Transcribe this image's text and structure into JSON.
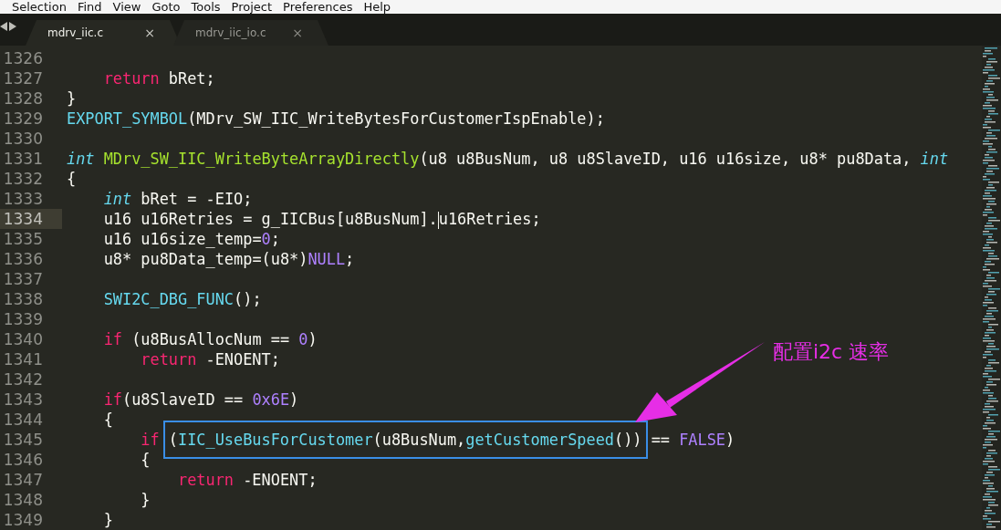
{
  "menu": [
    "Selection",
    "Find",
    "View",
    "Goto",
    "Tools",
    "Project",
    "Preferences",
    "Help"
  ],
  "tabs": [
    {
      "label": "mdrv_iic.c",
      "selected": true,
      "close": "×"
    },
    {
      "label": "mdrv_iic_io.c",
      "selected": false,
      "close": "×"
    }
  ],
  "editor": {
    "lines": [
      {
        "number": "1326",
        "current": false
      },
      {
        "number": "1327",
        "current": false,
        "tokens": [
          {
            "kind": "keyword",
            "text": "    return"
          },
          {
            "kind": "plain",
            "text": " bRet;"
          }
        ]
      },
      {
        "number": "1328",
        "current": false,
        "tokens": [
          {
            "kind": "plain",
            "text": "}"
          }
        ]
      },
      {
        "number": "1329",
        "current": false,
        "tokens": [
          {
            "kind": "call",
            "text": "EXPORT_SYMBOL"
          },
          {
            "kind": "plain",
            "text": "(MDrv_SW_IIC_WriteBytesForCustomerIspEnable);"
          }
        ]
      },
      {
        "number": "1330",
        "current": false
      },
      {
        "number": "1331",
        "current": false,
        "tokens": [
          {
            "kind": "type",
            "text": "int"
          },
          {
            "kind": "function",
            "text": " MDrv_SW_IIC_WriteByteArrayDirectly"
          },
          {
            "kind": "plain",
            "text": "(u8 u8BusNum, u8 u8SlaveID, u16 u16size, u8* pu8Data,"
          },
          {
            "kind": "type",
            "text": " int"
          }
        ]
      },
      {
        "number": "1332",
        "current": false,
        "tokens": [
          {
            "kind": "plain",
            "text": "{"
          }
        ]
      },
      {
        "number": "1333",
        "current": false,
        "tokens": [
          {
            "kind": "type",
            "text": "    int"
          },
          {
            "kind": "plain",
            "text": " bRet = -EIO;"
          }
        ]
      },
      {
        "number": "1334",
        "current": true,
        "tokens": [
          {
            "kind": "plain",
            "text": "    u16 u16Retries = g_IICBus[u8BusNum]."
          },
          {
            "kind": "caret"
          },
          {
            "kind": "plain",
            "text": "u16Retries;"
          }
        ]
      },
      {
        "number": "1335",
        "current": false,
        "tokens": [
          {
            "kind": "plain",
            "text": "    u16 u16size_temp="
          },
          {
            "kind": "constant",
            "text": "0"
          },
          {
            "kind": "plain",
            "text": ";"
          }
        ]
      },
      {
        "number": "1336",
        "current": false,
        "tokens": [
          {
            "kind": "plain",
            "text": "    u8* pu8Data_temp=(u8*)"
          },
          {
            "kind": "constant",
            "text": "NULL"
          },
          {
            "kind": "plain",
            "text": ";"
          }
        ]
      },
      {
        "number": "1337",
        "current": false
      },
      {
        "number": "1338",
        "current": false,
        "tokens": [
          {
            "kind": "call",
            "text": "    SWI2C_DBG_FUNC"
          },
          {
            "kind": "plain",
            "text": "();"
          }
        ]
      },
      {
        "number": "1339",
        "current": false
      },
      {
        "number": "1340",
        "current": false,
        "tokens": [
          {
            "kind": "keyword",
            "text": "    if"
          },
          {
            "kind": "plain",
            "text": " (u8BusAllocNum =="
          },
          {
            "kind": "constant",
            "text": " 0"
          },
          {
            "kind": "plain",
            "text": ")"
          }
        ]
      },
      {
        "number": "1341",
        "current": false,
        "tokens": [
          {
            "kind": "keyword",
            "text": "        return"
          },
          {
            "kind": "plain",
            "text": " -ENOENT;"
          }
        ]
      },
      {
        "number": "1342",
        "current": false
      },
      {
        "number": "1343",
        "current": false,
        "tokens": [
          {
            "kind": "keyword",
            "text": "    if"
          },
          {
            "kind": "plain",
            "text": "(u8SlaveID =="
          },
          {
            "kind": "constant",
            "text": " 0x6E"
          },
          {
            "kind": "plain",
            "text": ")"
          }
        ]
      },
      {
        "number": "1344",
        "current": false,
        "tokens": [
          {
            "kind": "plain",
            "text": "    {"
          }
        ]
      },
      {
        "number": "1345",
        "current": false,
        "tokens": [
          {
            "kind": "keyword",
            "text": "        if"
          },
          {
            "kind": "plain",
            "text": " (",
            "highlighted": true
          },
          {
            "kind": "call",
            "text": "IIC_UseBusForCustomer",
            "highlighted": true
          },
          {
            "kind": "plain",
            "text": "(u8BusNum,",
            "highlighted": true
          },
          {
            "kind": "call",
            "text": "getCustomerSpeed",
            "highlighted": true
          },
          {
            "kind": "plain",
            "text": "())",
            "highlighted": true
          },
          {
            "kind": "plain",
            "text": " =="
          },
          {
            "kind": "constant",
            "text": " FALSE"
          },
          {
            "kind": "plain",
            "text": ")"
          }
        ]
      },
      {
        "number": "1346",
        "current": false,
        "tokens": [
          {
            "kind": "plain",
            "text": "        {"
          }
        ]
      },
      {
        "number": "1347",
        "current": false,
        "tokens": [
          {
            "kind": "keyword",
            "text": "            return"
          },
          {
            "kind": "plain",
            "text": " -ENOENT;"
          }
        ]
      },
      {
        "number": "1348",
        "current": false,
        "tokens": [
          {
            "kind": "plain",
            "text": "        }"
          }
        ]
      },
      {
        "number": "1349",
        "current": false,
        "tokens": [
          {
            "kind": "plain",
            "text": "    }"
          }
        ]
      }
    ]
  },
  "annotation": {
    "label": "配置i2c 速率"
  }
}
